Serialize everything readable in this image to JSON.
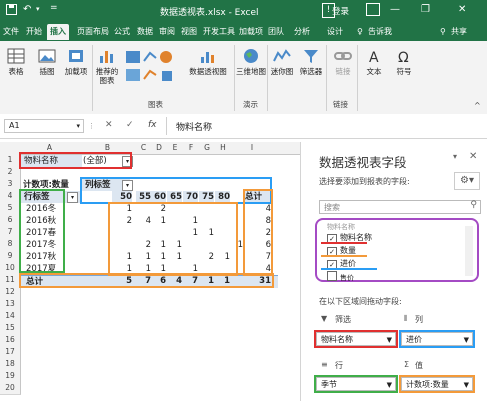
{
  "titlebar": {
    "save_icon": "save-icon",
    "undo_icon": "undo-icon",
    "title": "数据透视表.xlsx - Excel",
    "alert_icon": "!",
    "login": "登录",
    "minimize": "—",
    "restore": "❐",
    "close": "✕"
  },
  "tabs": [
    "文件",
    "开始",
    "插入",
    "页面布局",
    "公式",
    "数据",
    "审阅",
    "视图",
    "开发工具",
    "加载项",
    "团队",
    "分析",
    "设计"
  ],
  "tell_me": "告诉我",
  "share": "共享",
  "ribbon": {
    "table": "表格",
    "illustrations": "插图",
    "addins": "加载项",
    "recommended_charts": "推荐的图表",
    "pivot_chart": "数据透视图",
    "map_3d": "三维地图",
    "sparkline": "迷你图",
    "filter": "筛选器",
    "link": "链接",
    "text": "文本",
    "symbol": "符号",
    "group_chart": "图表",
    "group_demo": "演示",
    "group_link": "链接"
  },
  "formula_bar": {
    "name_box": "A1",
    "cancel": "✕",
    "confirm": "✓",
    "fx": "fx",
    "content": "物料名称"
  },
  "grid": {
    "columns": [
      "A",
      "B",
      "C",
      "D",
      "E",
      "F",
      "G",
      "H",
      "I"
    ],
    "rows": [
      "1",
      "2",
      "3",
      "4",
      "5",
      "6",
      "7",
      "8",
      "9",
      "10",
      "11",
      "12",
      "13",
      "14",
      "15",
      "16",
      "17",
      "18",
      "19",
      "20"
    ],
    "filter_label": "物料名称",
    "filter_value": "(全部)",
    "value_label": "计数项:数量",
    "col_label": "列标签",
    "row_label": "行标签",
    "headers": [
      "50",
      "55",
      "60",
      "65",
      "70",
      "75",
      "80",
      "总计"
    ],
    "row_items": [
      {
        "label": "2016冬",
        "values": [
          "",
          "1",
          "",
          "2",
          "",
          "",
          "",
          ""
        ],
        "total": "4"
      },
      {
        "label": "2016秋",
        "values": [
          "2",
          "4",
          "1",
          "",
          "1",
          "",
          "",
          ""
        ],
        "total": "8"
      },
      {
        "label": "2017春",
        "values": [
          "",
          "",
          "",
          "1",
          "1",
          "",
          "",
          ""
        ],
        "total": "2"
      },
      {
        "label": "2017冬",
        "values": [
          "",
          "2",
          "1",
          "1",
          "1",
          "",
          "",
          ""
        ],
        "total": "6"
      },
      {
        "label": "2017秋",
        "values": [
          "1",
          "1",
          "1",
          "1",
          "2",
          "1",
          "",
          ""
        ],
        "total": "7"
      },
      {
        "label": "2017夏",
        "values": [
          "1",
          "1",
          "1",
          "1",
          "",
          "",
          "",
          ""
        ],
        "total": "4"
      }
    ],
    "grand_total_label": "总计",
    "grand_total_values": [
      "5",
      "7",
      "6",
      "4",
      "7",
      "1",
      "1"
    ],
    "grand_total": "31"
  },
  "pane": {
    "title": "数据透视表字段",
    "subtitle": "选择要添加到报表的字段:",
    "search_placeholder": "搜索",
    "fields": [
      {
        "label": "物料名称",
        "checked": true
      },
      {
        "label": "数量",
        "checked": true
      },
      {
        "label": "进价",
        "checked": true
      },
      {
        "label": "售价",
        "checked": false
      }
    ],
    "drag_hint": "在以下区域间拖动字段:",
    "filters_title": "筛选",
    "columns_title": "列",
    "rows_title": "行",
    "values_title": "值",
    "filter_item": "物料名称",
    "column_item": "进价",
    "row_item": "季节",
    "value_item": "计数项:数量"
  },
  "colors": {
    "excel_green": "#217346",
    "red_box": "#e03030",
    "blue_box": "#2a9df4",
    "green_box": "#3fae49",
    "orange_box": "#f39a3a",
    "purple_box": "#a44bc4"
  }
}
